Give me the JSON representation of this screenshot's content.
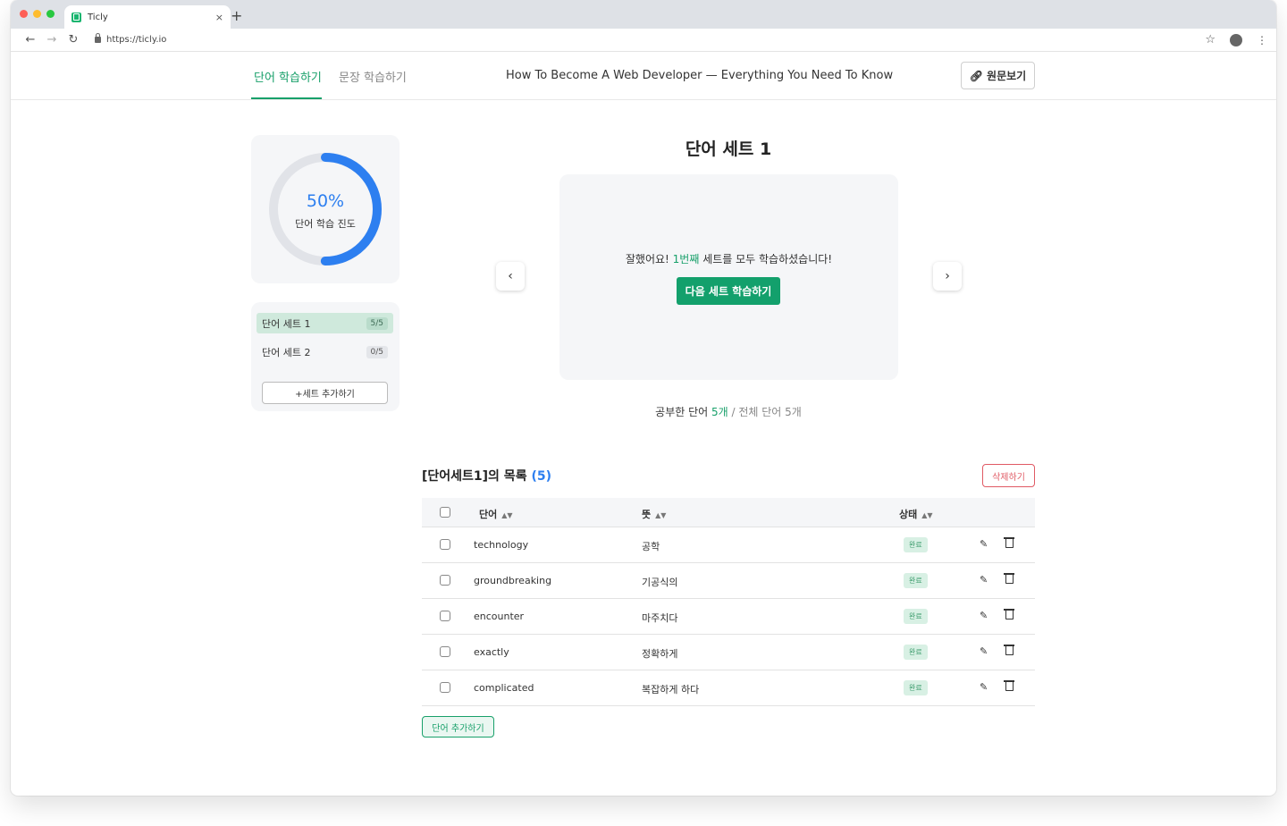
{
  "browser": {
    "traffic_colors": [
      "#fe5f57",
      "#febc2e",
      "#28c840"
    ],
    "tab_title": "Ticly",
    "tab_close": "×",
    "new_tab": "+",
    "url": "https://ticly.io"
  },
  "header": {
    "tabs": [
      {
        "label": "단어 학습하기",
        "active": true
      },
      {
        "label": "문장 학습하기",
        "active": false
      }
    ],
    "article_title": "How To Become A Web Developer — Everything You Need To Know",
    "source_button": "원문보기"
  },
  "progress": {
    "percent_value": 0.5,
    "percent_label": "50%",
    "label": "단어 학습 진도",
    "colors": {
      "fill": "#2d7ff0",
      "track": "#e1e3e8"
    }
  },
  "sets": {
    "items": [
      {
        "label": "단어 세트 1",
        "count": "5/5",
        "active": true
      },
      {
        "label": "단어 세트 2",
        "count": "0/5",
        "active": false
      }
    ],
    "add_button": "+세트 추가하기"
  },
  "study": {
    "set_title": "단어 세트 1",
    "message_prefix": "잘했어요! ",
    "message_highlight": "1번째",
    "message_suffix": " 세트를 모두 학습하셨습니다!",
    "next_button": "다음 세트 학습하기",
    "stats": {
      "studied_label": "공부한 단어 ",
      "studied_count": "5개",
      "separator": " / ",
      "total_label": "전체 단어 5개"
    }
  },
  "word_list": {
    "title": "[단어세트1]의 목록",
    "count": "(5)",
    "delete_button": "삭제하기",
    "columns": {
      "word": "단어",
      "meaning": "뜻",
      "status": "상태"
    },
    "rows": [
      {
        "word": "technology",
        "meaning": "공학",
        "status": "완료"
      },
      {
        "word": "groundbreaking",
        "meaning": "기공식의",
        "status": "완료"
      },
      {
        "word": "encounter",
        "meaning": "마주치다",
        "status": "완료"
      },
      {
        "word": "exactly",
        "meaning": "정확하게",
        "status": "완료"
      },
      {
        "word": "complicated",
        "meaning": "복잡하게 하다",
        "status": "완료"
      }
    ],
    "add_word_button": "단어 추가하기"
  }
}
